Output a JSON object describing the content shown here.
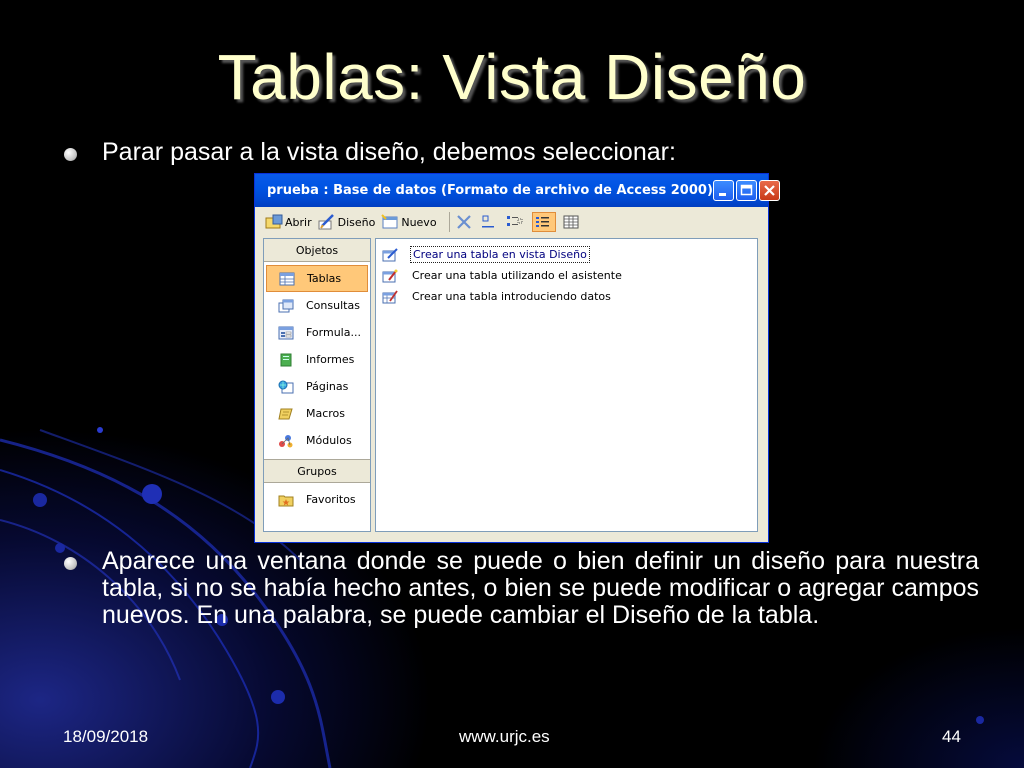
{
  "slide": {
    "title": "Tablas: Vista Diseño",
    "bullet1": "Parar pasar a la vista diseño, debemos seleccionar:",
    "bullet2": "Aparece una ventana donde se puede o bien definir un diseño para nuestra tabla, si no se había hecho antes, o bien se puede modificar o agregar campos nuevos. En una palabra, se puede cambiar el Diseño de la tabla."
  },
  "footer": {
    "date": "18/09/2018",
    "site": "www.urjc.es",
    "page": "44"
  },
  "window": {
    "title": "prueba : Base de datos (Formato de archivo de Access 2000)",
    "toolbar": {
      "open": "Abrir",
      "design": "Diseño",
      "new": "Nuevo"
    },
    "nav": {
      "objects_header": "Objetos",
      "groups_header": "Grupos",
      "items": [
        {
          "label": "Tablas",
          "icon": "table-icon"
        },
        {
          "label": "Consultas",
          "icon": "query-icon"
        },
        {
          "label": "Formula...",
          "icon": "form-icon"
        },
        {
          "label": "Informes",
          "icon": "report-icon"
        },
        {
          "label": "Páginas",
          "icon": "page-icon"
        },
        {
          "label": "Macros",
          "icon": "macro-icon"
        },
        {
          "label": "Módulos",
          "icon": "module-icon"
        }
      ],
      "favorites": "Favoritos"
    },
    "list": [
      "Crear una tabla en vista Diseño",
      "Crear una tabla utilizando el asistente",
      "Crear una tabla introduciendo datos"
    ]
  },
  "colors": {
    "title": "#ffffcc",
    "titlebar": "#0054e3",
    "selection": "#ffc879"
  }
}
